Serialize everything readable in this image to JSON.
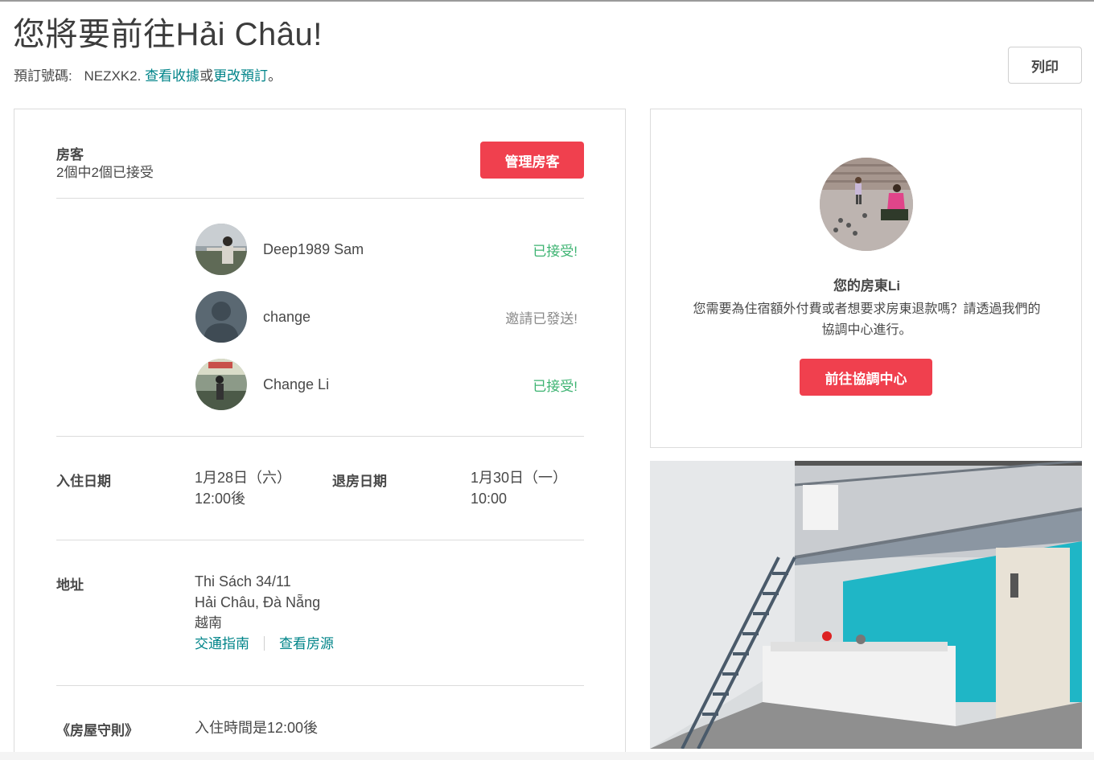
{
  "header": {
    "title": "您將要前往Hải Châu!",
    "booking_prefix": "預訂號碼:",
    "booking_code": "NEZXK2.",
    "view_receipt": "查看收據",
    "or": "或",
    "change_booking": "更改預訂",
    "period": "。",
    "print_label": "列印"
  },
  "guests": {
    "label": "房客",
    "summary": "2個中2個已接受",
    "manage_button": "管理房客",
    "list": [
      {
        "name": "Deep1989 Sam",
        "status": "已接受!"
      },
      {
        "name": "change",
        "status": "邀請已發送!"
      },
      {
        "name": "Change Li",
        "status": "已接受!"
      }
    ]
  },
  "dates": {
    "checkin_label": "入住日期",
    "checkin_date": "1月28日（六）",
    "checkin_time": "12:00後",
    "checkout_label": "退房日期",
    "checkout_date": "1月30日（一）",
    "checkout_time": "10:00"
  },
  "address": {
    "label": "地址",
    "line1": "Thi Sách 34/11",
    "line2": "Hải Châu, Đà Nẵng",
    "line3": "越南",
    "directions_link": "交通指南",
    "listing_link": "查看房源"
  },
  "rules": {
    "label": "《房屋守則》",
    "text": "入住時間是12:00後"
  },
  "host": {
    "name": "您的房東Li",
    "message": "您需要為住宿額外付費或者想要求房東退款嗎？請透過我們的協調中心進行。",
    "resolution_button": "前往協調中心"
  },
  "colors": {
    "accent_red": "#f0404e",
    "link_teal": "#008489",
    "accepted_green": "#3cb371"
  }
}
